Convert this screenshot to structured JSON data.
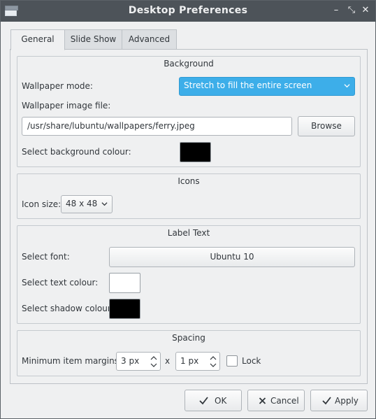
{
  "window": {
    "title": "Desktop Preferences",
    "controls": [
      "minimize-icon",
      "maximize-icon",
      "close-icon"
    ],
    "minimize_glyph": "–",
    "maximize_glyph": "⤡",
    "close_glyph": "✕"
  },
  "tabs": [
    {
      "label": "General",
      "active": true
    },
    {
      "label": "Slide Show",
      "active": false
    },
    {
      "label": "Advanced",
      "active": false
    }
  ],
  "background": {
    "title": "Background",
    "wallpaper_mode_label": "Wallpaper mode:",
    "wallpaper_mode_value": "Stretch to fill the entire screen",
    "image_file_label": "Wallpaper image file:",
    "image_file_value": "/usr/share/lubuntu/wallpapers/ferry.jpeg",
    "browse_label": "Browse",
    "bg_colour_label": "Select background colour:",
    "bg_colour": "#000000"
  },
  "icons": {
    "title": "Icons",
    "icon_size_label": "Icon size:",
    "icon_size_value": "48 x 48"
  },
  "label_text": {
    "title": "Label Text",
    "font_label": "Select font:",
    "font_value": "Ubuntu 10",
    "text_colour_label": "Select text colour:",
    "text_colour": "#ffffff",
    "shadow_colour_label": "Select shadow colour:",
    "shadow_colour": "#000000"
  },
  "spacing": {
    "title": "Spacing",
    "margins_label": "Minimum item margins:",
    "margin_x": "3 px",
    "separator": "x",
    "margin_y": "1 px",
    "lock_label": "Lock",
    "lock_checked": false
  },
  "buttons": {
    "ok": "OK",
    "cancel": "Cancel",
    "apply": "Apply"
  },
  "colors": {
    "accent": "#3daee9",
    "titlebar": "#4d5359",
    "window_bg": "#eff0f1"
  }
}
